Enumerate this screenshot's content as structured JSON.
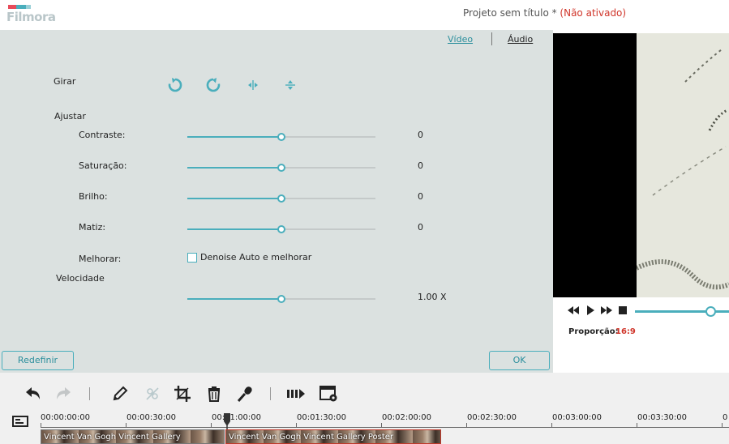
{
  "app": {
    "logo_text": "Filmora",
    "project_title": "Projeto sem título *",
    "activation_status": "(Não ativado)"
  },
  "tabs": [
    {
      "label": "Vídeo",
      "active": true
    },
    {
      "label": "Áudio",
      "active": false
    }
  ],
  "editor": {
    "rotate_label": "Girar",
    "rotate_buttons": [
      "rotate-clockwise-icon",
      "rotate-counterclockwise-icon",
      "flip-horizontal-icon",
      "flip-vertical-icon"
    ],
    "adjust_label": "Ajustar",
    "adjustments": [
      {
        "label": "Contraste:",
        "value": "0",
        "level": 0.5
      },
      {
        "label": "Saturação:",
        "value": "0",
        "level": 0.5
      },
      {
        "label": "Brilho:",
        "value": "0",
        "level": 0.5
      },
      {
        "label": "Matiz:",
        "value": "0",
        "level": 0.5
      }
    ],
    "enhance_label": "Melhorar:",
    "enhance_option": "Denoise Auto e melhorar",
    "enhance_checked": false,
    "speed_label": "Velocidade",
    "speed_value": "1.00 X",
    "speed_level": 0.5,
    "reset_button": "Redefinir",
    "ok_button": "OK"
  },
  "preview": {
    "ratio_label": "Proporção:",
    "ratio_value": "16:9",
    "progress": 0.8
  },
  "toolbar": {
    "tools": [
      "undo-icon",
      "redo-icon",
      "edit-pencil-icon",
      "effects-icon",
      "crop-icon",
      "delete-icon",
      "voiceover-mic-icon",
      "split-screen-icon",
      "render-settings-icon"
    ]
  },
  "timeline": {
    "ticks": [
      "00:00:00:00",
      "00:00:30:00",
      "00:01:00:00",
      "00:01:30:00",
      "00:02:00:00",
      "00:02:30:00",
      "00:03:00:00",
      "00:03:30:00",
      "0"
    ],
    "clips": [
      {
        "label": "Vincent Van Gogh Vincent Gallery"
      },
      {
        "label": "Vincent Van Gogh Vincent Gallery Poster"
      }
    ]
  },
  "colors": {
    "accent": "#4aaebc",
    "accent_text": "#2a8e9c",
    "status_red": "#d0362b",
    "panel_bg": "#dbe1e0"
  }
}
